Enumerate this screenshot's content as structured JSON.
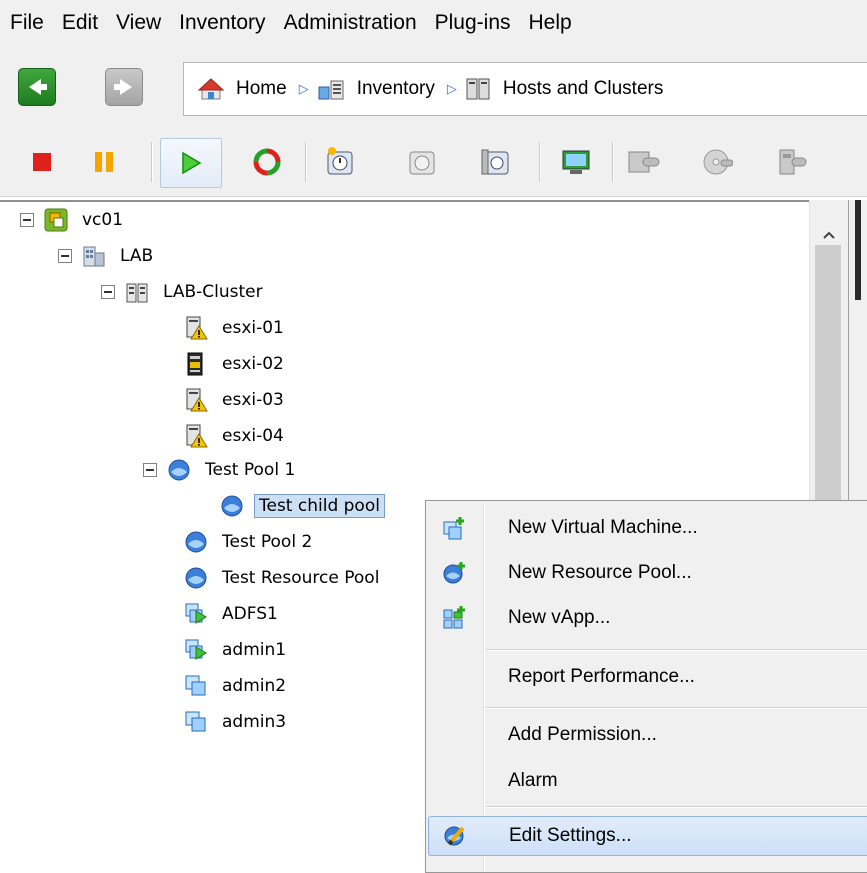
{
  "menubar": {
    "items": [
      "File",
      "Edit",
      "View",
      "Inventory",
      "Administration",
      "Plug-ins",
      "Help"
    ]
  },
  "breadcrumb": {
    "items": [
      "Home",
      "Inventory",
      "Hosts and Clusters"
    ]
  },
  "tree": {
    "root": "vc01",
    "datacenter": "LAB",
    "cluster": "LAB-Cluster",
    "hosts": [
      "esxi-01",
      "esxi-02",
      "esxi-03",
      "esxi-04"
    ],
    "pool1": "Test Pool 1",
    "child_pool": "Test child pool",
    "pool2": "Test Pool 2",
    "resource_pool": "Test Resource Pool",
    "vms": [
      "ADFS1",
      "admin1",
      "admin2",
      "admin3"
    ]
  },
  "context_menu": {
    "items": [
      "New Virtual Machine...",
      "New Resource Pool...",
      "New vApp...",
      "Report Performance...",
      "Add Permission...",
      "Alarm",
      "Edit Settings..."
    ],
    "highlighted": "Edit Settings..."
  },
  "colors": {
    "selection": "#cce0f5",
    "menu_highlight": "#cde0f7",
    "stop_red": "#e0201b",
    "pause_orange": "#f5a500",
    "play_green": "#20a020"
  }
}
